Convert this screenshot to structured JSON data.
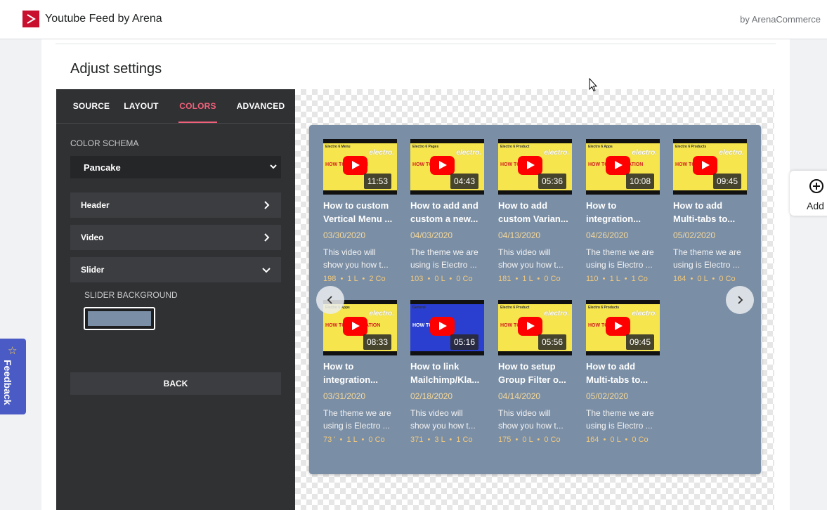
{
  "app": {
    "title": "Youtube Feed by Arena",
    "by": "by ArenaCommerce"
  },
  "page": {
    "title": "Adjust settings"
  },
  "panel": {
    "tabs": [
      {
        "label": "SOURCE"
      },
      {
        "label": "LAYOUT"
      },
      {
        "label": "COLORS"
      },
      {
        "label": "ADVANCED"
      }
    ],
    "active_tab": "COLORS",
    "color_schema_label": "COLOR SCHEMA",
    "color_schema_value": "Pancake",
    "sections": [
      {
        "label": "Header"
      },
      {
        "label": "Video"
      },
      {
        "label": "Slider"
      }
    ],
    "slider_background_label": "SLIDER BACKGROUND",
    "slider_background_color": "#7a8ea5",
    "back_label": "BACK"
  },
  "feed": {
    "videos": [
      {
        "top": "Electro 6   Menu",
        "headline": "HOW TO CUSTOM",
        "duration": "11:53",
        "title": "How to custom\nVertical Menu ...",
        "date": "03/30/2020",
        "desc": "This video will\nshow you how t...",
        "stats": "198  •  1 L  •  2 Co"
      },
      {
        "top": "Electro 6   Pages",
        "headline": "HOW TO ADD",
        "duration": "04:43",
        "title": "How to add and\ncustom a new...",
        "date": "04/03/2020",
        "desc": "The theme we are\nusing is Electro ...",
        "stats": "103  •  0 L  •  0 Co"
      },
      {
        "top": "Electro 6   Product",
        "headline": "HOW TO ADD",
        "duration": "05:36",
        "title": "How to add\ncustom Varian...",
        "date": "04/13/2020",
        "desc": "This video will\nshow you how t...",
        "stats": "181  •  1 L  •  0 Co"
      },
      {
        "top": "Electro 6   Apps",
        "headline": "HOW TO INTEGRATION",
        "duration": "10:08",
        "title": "How to\nintegration...",
        "date": "04/26/2020",
        "desc": "The theme we are\nusing is Electro ...",
        "stats": "110  •  1 L  •  1 Co"
      },
      {
        "top": "Electro 6   Products",
        "headline": "HOW TO ADD",
        "duration": "09:45",
        "title": "How to add\nMulti-tabs to...",
        "date": "05/02/2020",
        "desc": "The theme we are\nusing is Electro ...",
        "stats": "164  •  0 L  •  0 Co"
      },
      {
        "top": "Electro 6   Apps",
        "headline": "HOW TO INTEGRATION",
        "duration": "08:33",
        "title": "How to\nintegration...",
        "date": "03/31/2020",
        "desc": "The theme we are\nusing is Electro ...",
        "stats": "73 '  •  1 L  •  0 Co"
      },
      {
        "top": "General",
        "headline": "HOW TO LINK",
        "duration": "05:16",
        "title": "How to link\nMailchimp/Kla...",
        "date": "02/18/2020",
        "desc": "This video will\nshow you how t...",
        "stats": "371  •  3 L  •  1 Co"
      },
      {
        "top": "Electro 6   Product",
        "headline": "HOW TO SETUP",
        "duration": "05:56",
        "title": "How to setup\nGroup Filter o...",
        "date": "04/14/2020",
        "desc": "This video will\nshow you how t...",
        "stats": "175  •  0 L  •  0 Co"
      },
      {
        "top": "Electro 6   Products",
        "headline": "HOW TO ADD",
        "duration": "09:45",
        "title": "How to add\nMulti-tabs to...",
        "date": "05/02/2020",
        "desc": "The theme we are\nusing is Electro ...",
        "stats": "164  •  0 L  •  0 Co"
      }
    ],
    "brand": "electro.",
    "prev_icon": "chevron-left-icon",
    "next_icon": "chevron-right-icon"
  },
  "side": {
    "add_label": "Add",
    "add_icon": "plus-circle-icon"
  },
  "feedback": {
    "label": "Feedback",
    "icon": "star-icon"
  },
  "colors": {
    "accent": "#f0607a",
    "panel": "#303133",
    "slider_bg": "#7a8ea5",
    "brand_red": "#c8102e",
    "feedback": "#4b5bc6"
  }
}
